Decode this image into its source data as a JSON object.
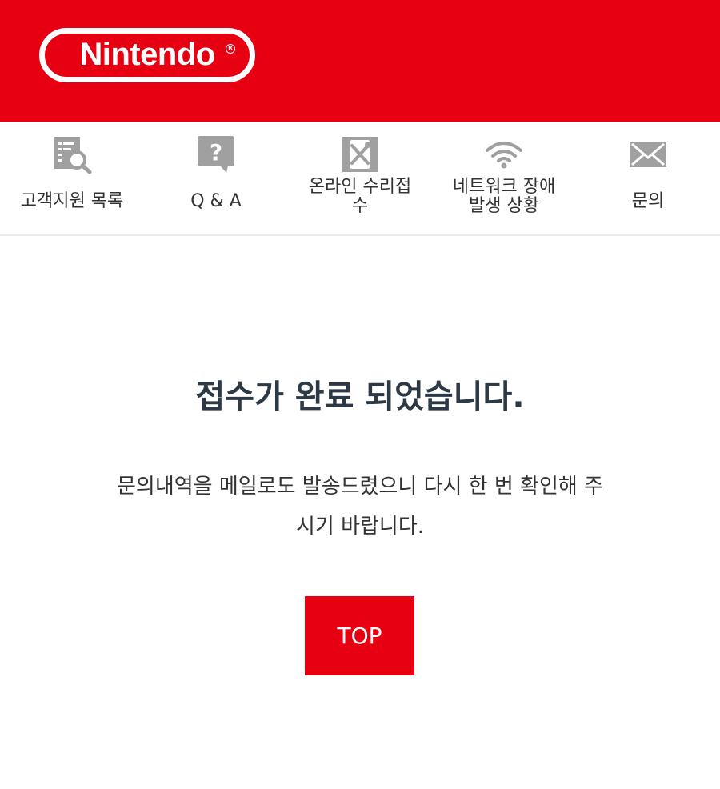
{
  "header": {
    "brand": "Nintendo",
    "brand_color": "#e60012"
  },
  "nav": {
    "items": [
      {
        "label": "고객지원 목록",
        "icon": "document-search-icon"
      },
      {
        "label": "Q & A",
        "icon": "question-bubble-icon"
      },
      {
        "label_line1": "온라인 수리접",
        "label_line2": "수",
        "icon": "repair-tools-icon"
      },
      {
        "label_line1": "네트워크 장애",
        "label_line2": "발생 상황",
        "icon": "wifi-icon"
      },
      {
        "label": "문의",
        "icon": "mail-icon"
      }
    ]
  },
  "main": {
    "title": "접수가 완료 되었습니다.",
    "description_line1": "문의내역을 메일로도 발송드렸으니 다시 한 번 확인해 주",
    "description_line2": "시기 바랍니다.",
    "top_button_label": "TOP"
  }
}
